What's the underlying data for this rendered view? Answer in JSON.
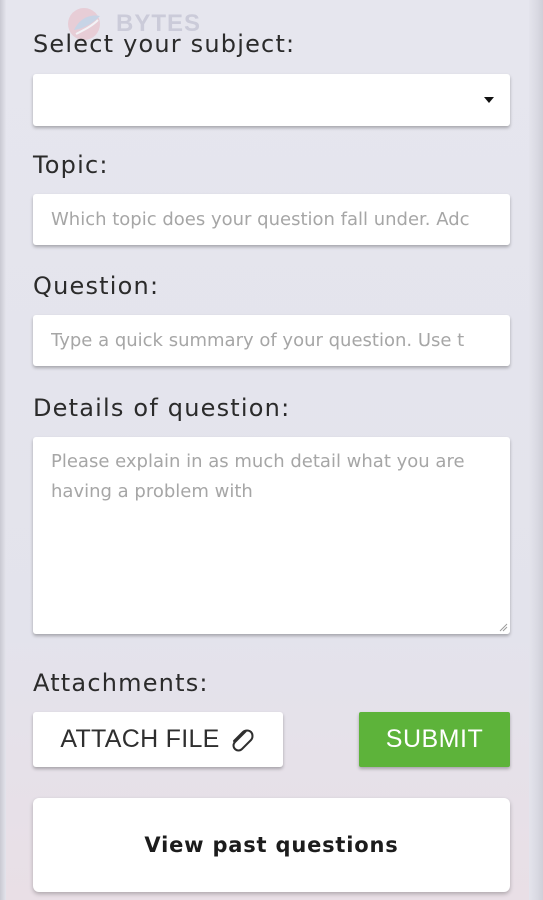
{
  "brand": {
    "watermark_text": "BYTES",
    "logo_icon": "bytes-logo-icon"
  },
  "form": {
    "subject": {
      "label": "Select your subject:",
      "selected_value": "",
      "caret_icon": "caret-down-icon"
    },
    "topic": {
      "label": "Topic:",
      "placeholder": "Which topic does your question fall under. Adc",
      "value": ""
    },
    "question": {
      "label": "Question:",
      "placeholder": "Type a quick summary of your question. Use t",
      "value": ""
    },
    "details": {
      "label": "Details of question:",
      "placeholder": "Please explain in as much detail what you are having a problem with",
      "value": ""
    },
    "attachments": {
      "label": "Attachments:",
      "attach_button_label": "ATTACH FILE",
      "attach_icon": "paperclip-icon"
    },
    "submit_label": "SUBMIT"
  },
  "footer": {
    "past_questions_label": "View past questions"
  },
  "colors": {
    "submit_green": "#5db33a",
    "panel_background": "#e6e6ee",
    "field_background": "#ffffff"
  }
}
